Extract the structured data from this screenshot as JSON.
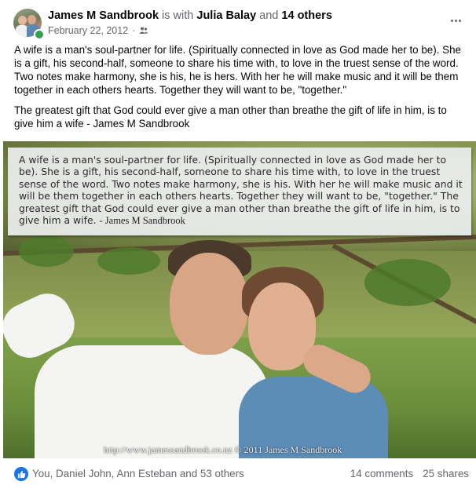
{
  "header": {
    "author": "James M Sandbrook",
    "is_with_text": "is with",
    "tagged_person": "Julia Balay",
    "and_text": "and",
    "others_text": "14 others",
    "date": "February 22, 2012",
    "dot": "·",
    "audience_icon": "friends-icon",
    "more_icon": "more-options-icon"
  },
  "post": {
    "paragraph1": "A wife is a man's soul-partner for life. (Spiritually connected in love as God made her to be). She is a gift, his second-half, someone to share his time with, to love in the truest sense of the word. Two notes make harmony, she is his, he is hers. With her he will make music and it will be them together in each others hearts. Together they will want to be, \"together.\"",
    "paragraph2": "The greatest gift that God could ever give a man other than breathe the gift of life in him, is to give him a wife - James M Sandbrook"
  },
  "photo": {
    "caption": "A wife is a man's soul-partner for life. (Spiritually connected in love as God made her to be). She is a gift, his second-half, someone to share his time with, to love in the truest sense of the word. Two notes make harmony, she is his. With her he will make music and it will be them together in each others hearts. Together they will want to be, \"together.\" The greatest gift that God could ever give a man other than breathe the gift of life in him, is to give him a wife.",
    "signature": "- James M Sandbrook",
    "watermark": "http://www.jamessandbrook.co.nz © 2011 James M Sandbrook"
  },
  "footer": {
    "reaction_icon": "like-icon",
    "reactors": "You, Daniel John, Ann Esteban and 53 others",
    "comments": "14 comments",
    "shares": "25 shares"
  },
  "colors": {
    "like_blue": "#1b74e4",
    "online_green": "#31a24c",
    "secondary_text": "#65676b"
  }
}
